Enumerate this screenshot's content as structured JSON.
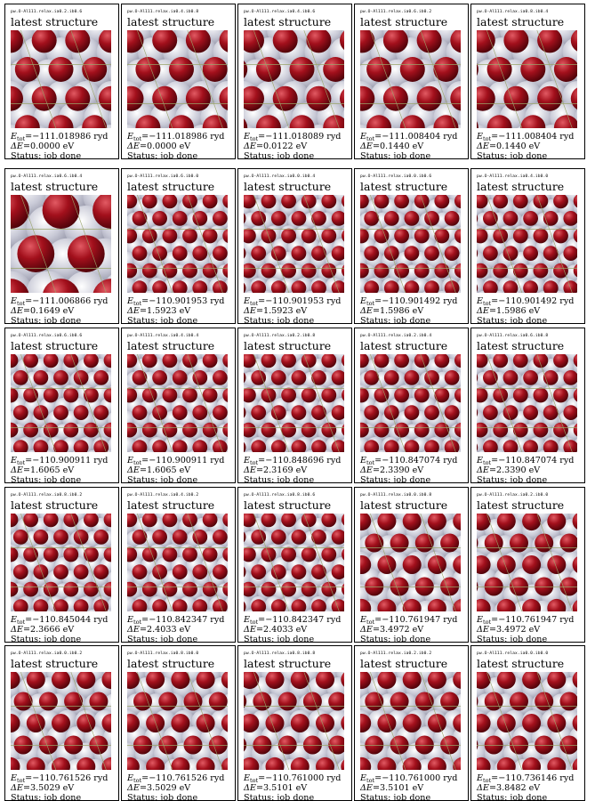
{
  "labels": {
    "subtitle": "latest structure",
    "energy_symbol": "E",
    "energy_sub": "tot",
    "delta_symbol": "ΔE",
    "energy_unit": "ryd",
    "delta_unit": "eV",
    "status_prefix": "Status:"
  },
  "colors": {
    "oxygen": "#a3101c",
    "surface": "#c8c9d6",
    "surface_dark": "#7f8094",
    "cell_line": "#9aa56a"
  },
  "cells": [
    {
      "title": "pw.O-Al111.relax.ia0.2.ib0.6",
      "energy": "−111.018986",
      "delta": "0.0000",
      "status": "job done",
      "density": 3
    },
    {
      "title": "pw.O-Al111.relax.ia0.4.ib0.8",
      "energy": "−111.018986",
      "delta": "0.0000",
      "status": "job done",
      "density": 3
    },
    {
      "title": "pw.O-Al111.relax.ia0.4.ib0.6",
      "energy": "−111.018089",
      "delta": "0.0122",
      "status": "job done",
      "density": 3
    },
    {
      "title": "pw.O-Al111.relax.ia0.6.ib0.2",
      "energy": "−111.008404",
      "delta": "0.1440",
      "status": "job done",
      "density": 3
    },
    {
      "title": "pw.O-Al111.relax.ia0.8.ib0.4",
      "energy": "−111.008404",
      "delta": "0.1440",
      "status": "job done",
      "density": 3
    },
    {
      "title": "pw.O-Al111.relax.ia0.6.ib0.4",
      "energy": "−111.006866",
      "delta": "0.1649",
      "status": "job done",
      "density": 2
    },
    {
      "title": "pw.O-Al111.relax.ia0.6.ib0.0",
      "energy": "−110.901953",
      "delta": "1.5923",
      "status": "job done",
      "density": 5
    },
    {
      "title": "pw.O-Al111.relax.ia0.0.ib0.4",
      "energy": "−110.901953",
      "delta": "1.5923",
      "status": "job done",
      "density": 5
    },
    {
      "title": "pw.O-Al111.relax.ia0.0.ib0.6",
      "energy": "−110.901492",
      "delta": "1.5986",
      "status": "job done",
      "density": 5
    },
    {
      "title": "pw.O-Al111.relax.ia0.4.ib0.0",
      "energy": "−110.901492",
      "delta": "1.5986",
      "status": "job done",
      "density": 5
    },
    {
      "title": "pw.O-Al111.relax.ia0.6.ib0.6",
      "energy": "−110.900911",
      "delta": "1.6065",
      "status": "job done",
      "density": 5
    },
    {
      "title": "pw.O-Al111.relax.ia0.4.ib0.4",
      "energy": "−110.900911",
      "delta": "1.6065",
      "status": "job done",
      "density": 5
    },
    {
      "title": "pw.O-Al111.relax.ia0.2.ib0.8",
      "energy": "−110.848696",
      "delta": "2.3169",
      "status": "job done",
      "density": 5
    },
    {
      "title": "pw.O-Al111.relax.ia0.2.ib0.4",
      "energy": "−110.847074",
      "delta": "2.3390",
      "status": "job done",
      "density": 5
    },
    {
      "title": "pw.O-Al111.relax.ia0.6.ib0.8",
      "energy": "−110.847074",
      "delta": "2.3390",
      "status": "job done",
      "density": 5
    },
    {
      "title": "pw.O-Al111.relax.ia0.8.ib0.2",
      "energy": "−110.845044",
      "delta": "2.3666",
      "status": "job done",
      "density": 5
    },
    {
      "title": "pw.O-Al111.relax.ia0.4.ib0.2",
      "energy": "−110.842347",
      "delta": "2.4033",
      "status": "job done",
      "density": 5
    },
    {
      "title": "pw.O-Al111.relax.ia0.8.ib0.6",
      "energy": "−110.842347",
      "delta": "2.4033",
      "status": "job done",
      "density": 5
    },
    {
      "title": "pw.O-Al111.relax.ia0.0.ib0.8",
      "energy": "−110.761947",
      "delta": "3.4972",
      "status": "job done",
      "density": 4
    },
    {
      "title": "pw.O-Al111.relax.ia0.2.ib0.0",
      "energy": "−110.761947",
      "delta": "3.4972",
      "status": "job done",
      "density": 4
    },
    {
      "title": "pw.O-Al111.relax.ia0.0.ib0.2",
      "energy": "−110.761526",
      "delta": "3.5029",
      "status": "job done",
      "density": 4
    },
    {
      "title": "pw.O-Al111.relax.ia0.8.ib0.0",
      "energy": "−110.761526",
      "delta": "3.5029",
      "status": "job done",
      "density": 4
    },
    {
      "title": "pw.O-Al111.relax.ia0.8.ib0.8",
      "energy": "−110.761000",
      "delta": "3.5101",
      "status": "job done",
      "density": 4
    },
    {
      "title": "pw.O-Al111.relax.ia0.2.ib0.2",
      "energy": "−110.761000",
      "delta": "3.5101",
      "status": "job done",
      "density": 4
    },
    {
      "title": "pw.O-Al111.relax.ia0.0.ib0.0",
      "energy": "−110.736146",
      "delta": "3.8482",
      "status": "job done",
      "density": 4
    }
  ]
}
